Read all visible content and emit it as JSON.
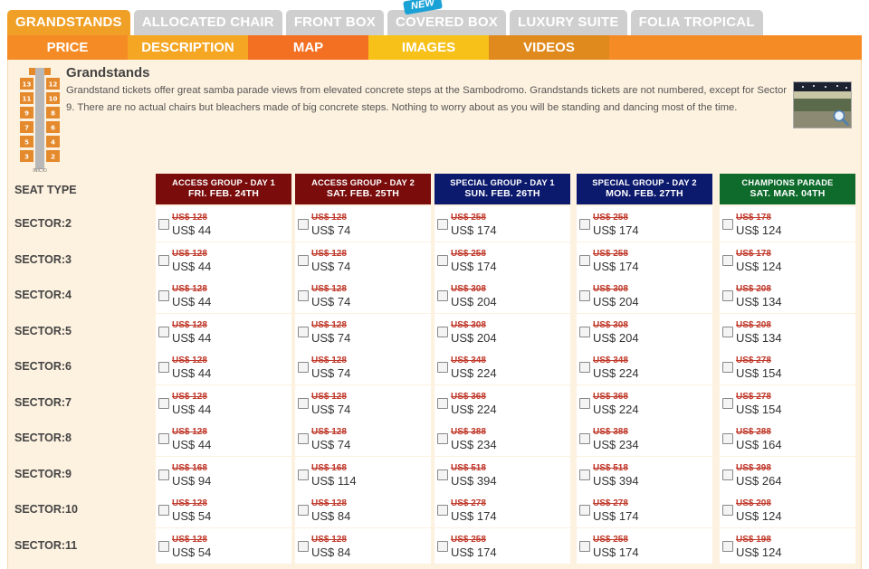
{
  "tabs": [
    {
      "label": "GRANDSTANDS",
      "active": true
    },
    {
      "label": "ALLOCATED CHAIR",
      "active": false
    },
    {
      "label": "FRONT BOX",
      "active": false
    },
    {
      "label": "COVERED BOX",
      "active": false,
      "badge": "NEW"
    },
    {
      "label": "LUXURY SUITE",
      "active": false
    },
    {
      "label": "FOLIA TROPICAL",
      "active": false
    }
  ],
  "subtabs": [
    {
      "label": "PRICE",
      "color": "#f58b25"
    },
    {
      "label": "DESCRIPTION",
      "color": "#f5a623"
    },
    {
      "label": "MAP",
      "color": "#f36f21"
    },
    {
      "label": "IMAGES",
      "color": "#f7c11a"
    },
    {
      "label": "VIDEOS",
      "color": "#e08a1e"
    }
  ],
  "intro": {
    "title": "Grandstands",
    "text": "Grandstand tickets offer great samba parade views from elevated concrete steps at the Sambodromo. Grandstands tickets are not numbered, except for Sector 9. There are no actual chairs but bleachers made of big concrete steps. Nothing to worry about as you will be standing and dancing most of the time."
  },
  "map_thumb": {
    "labels": [
      "13",
      "12",
      "11",
      "10",
      "9",
      "8",
      "7",
      "6",
      "5",
      "4",
      "3",
      "2"
    ],
    "caption": "INÍCIO"
  },
  "table": {
    "seat_type_label": "SEAT TYPE",
    "groups": [
      {
        "name": "ACCESS GROUP - DAY 1",
        "date": "FRI. FEB. 24TH",
        "color": "#7a0c0c"
      },
      {
        "name": "ACCESS GROUP - DAY 2",
        "date": "SAT. FEB. 25TH",
        "color": "#7a0c0c"
      },
      {
        "name": "SPECIAL GROUP - DAY 1",
        "date": "SUN. FEB. 26TH",
        "color": "#0c1a6e"
      },
      {
        "name": "SPECIAL GROUP - DAY 2",
        "date": "MON. FEB. 27TH",
        "color": "#0c1a6e"
      },
      {
        "name": "CHAMPIONS PARADE",
        "date": "SAT. MAR. 04TH",
        "color": "#0e6b2c"
      }
    ],
    "rows": [
      {
        "sector": "SECTOR:2",
        "prices": [
          [
            "US$ 128",
            "US$ 44"
          ],
          [
            "US$ 128",
            "US$ 74"
          ],
          [
            "US$ 258",
            "US$ 174"
          ],
          [
            "US$ 258",
            "US$ 174"
          ],
          [
            "US$ 178",
            "US$ 124"
          ]
        ]
      },
      {
        "sector": "SECTOR:3",
        "prices": [
          [
            "US$ 128",
            "US$ 44"
          ],
          [
            "US$ 128",
            "US$ 74"
          ],
          [
            "US$ 258",
            "US$ 174"
          ],
          [
            "US$ 258",
            "US$ 174"
          ],
          [
            "US$ 178",
            "US$ 124"
          ]
        ]
      },
      {
        "sector": "SECTOR:4",
        "prices": [
          [
            "US$ 128",
            "US$ 44"
          ],
          [
            "US$ 128",
            "US$ 74"
          ],
          [
            "US$ 308",
            "US$ 204"
          ],
          [
            "US$ 308",
            "US$ 204"
          ],
          [
            "US$ 208",
            "US$ 134"
          ]
        ]
      },
      {
        "sector": "SECTOR:5",
        "prices": [
          [
            "US$ 128",
            "US$ 44"
          ],
          [
            "US$ 128",
            "US$ 74"
          ],
          [
            "US$ 308",
            "US$ 204"
          ],
          [
            "US$ 308",
            "US$ 204"
          ],
          [
            "US$ 208",
            "US$ 134"
          ]
        ]
      },
      {
        "sector": "SECTOR:6",
        "prices": [
          [
            "US$ 128",
            "US$ 44"
          ],
          [
            "US$ 128",
            "US$ 74"
          ],
          [
            "US$ 348",
            "US$ 224"
          ],
          [
            "US$ 348",
            "US$ 224"
          ],
          [
            "US$ 278",
            "US$ 154"
          ]
        ]
      },
      {
        "sector": "SECTOR:7",
        "prices": [
          [
            "US$ 128",
            "US$ 44"
          ],
          [
            "US$ 128",
            "US$ 74"
          ],
          [
            "US$ 368",
            "US$ 224"
          ],
          [
            "US$ 368",
            "US$ 224"
          ],
          [
            "US$ 278",
            "US$ 154"
          ]
        ]
      },
      {
        "sector": "SECTOR:8",
        "prices": [
          [
            "US$ 128",
            "US$ 44"
          ],
          [
            "US$ 128",
            "US$ 74"
          ],
          [
            "US$ 388",
            "US$ 234"
          ],
          [
            "US$ 388",
            "US$ 234"
          ],
          [
            "US$ 288",
            "US$ 164"
          ]
        ]
      },
      {
        "sector": "SECTOR:9",
        "prices": [
          [
            "US$ 168",
            "US$ 94"
          ],
          [
            "US$ 168",
            "US$ 114"
          ],
          [
            "US$ 518",
            "US$ 394"
          ],
          [
            "US$ 518",
            "US$ 394"
          ],
          [
            "US$ 398",
            "US$ 264"
          ]
        ]
      },
      {
        "sector": "SECTOR:10",
        "prices": [
          [
            "US$ 128",
            "US$ 54"
          ],
          [
            "US$ 128",
            "US$ 84"
          ],
          [
            "US$ 278",
            "US$ 174"
          ],
          [
            "US$ 278",
            "US$ 174"
          ],
          [
            "US$ 208",
            "US$ 124"
          ]
        ]
      },
      {
        "sector": "SECTOR:11",
        "prices": [
          [
            "US$ 128",
            "US$ 54"
          ],
          [
            "US$ 128",
            "US$ 84"
          ],
          [
            "US$ 258",
            "US$ 174"
          ],
          [
            "US$ 258",
            "US$ 174"
          ],
          [
            "US$ 198",
            "US$ 124"
          ]
        ]
      }
    ]
  }
}
